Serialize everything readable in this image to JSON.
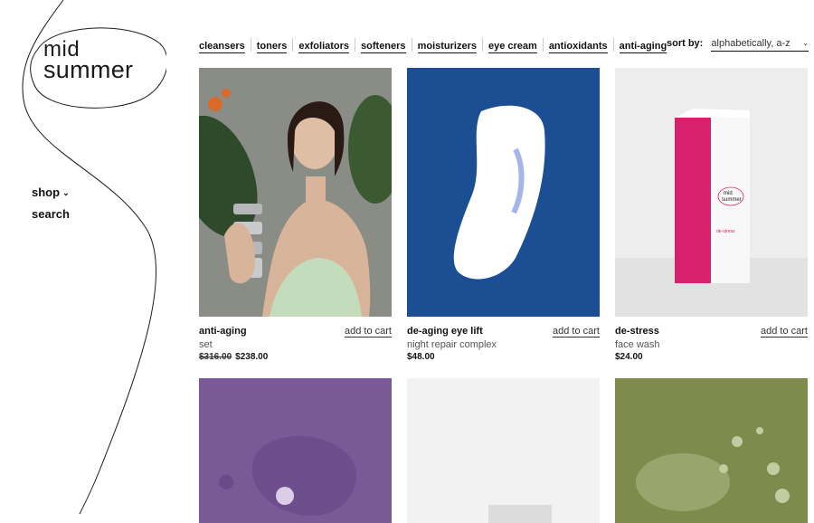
{
  "brand": {
    "line1": "mid",
    "line2": "summer"
  },
  "side_nav": {
    "shop": "shop",
    "search": "search"
  },
  "categories": [
    "cleansers",
    "toners",
    "exfoliators",
    "softeners",
    "moisturizers",
    "eye cream",
    "antioxidants",
    "anti-aging"
  ],
  "sort": {
    "label": "sort by:",
    "value": "alphabetically, a-z"
  },
  "products": [
    {
      "name": "anti-aging",
      "subtitle": "set",
      "old_price": "$316.00",
      "price": "$238.00",
      "cart": "add to cart",
      "bg": "#8a8d86"
    },
    {
      "name": "de-aging eye lift",
      "subtitle": "night repair complex",
      "price": "$48.00",
      "cart": "add to cart",
      "bg": "#1b4e92"
    },
    {
      "name": "de-stress",
      "subtitle": "face wash",
      "price": "$24.00",
      "cart": "add to cart",
      "bg": "#ededed"
    }
  ],
  "row2_bgs": [
    "#7a5a96",
    "#f2f2f2",
    "#7e8b4c"
  ],
  "box_text": {
    "brand1": "mid",
    "brand2": "summer",
    "name": "de-stress"
  },
  "colors": {
    "box_pink": "#d6226c",
    "text": "#111111"
  }
}
